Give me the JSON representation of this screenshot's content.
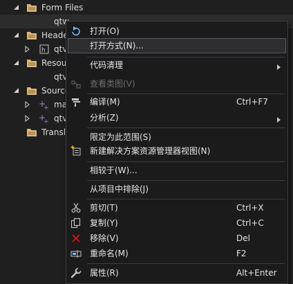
{
  "tree": {
    "form_files": "Form Files",
    "form_child": "qtw",
    "header_files": "Heade",
    "header_child": "qtv",
    "resource_files": "Resou",
    "resource_child": "qtv",
    "source_files": "Source",
    "source_child1": "ma",
    "source_child2": "qtv",
    "translation_files": "Transl"
  },
  "menu": {
    "open": "打开(O)",
    "open_with": "打开方式(N)...",
    "code_cleanup": "代码清理",
    "view_class_diagram": "查看类图(V)",
    "compile": "编译(M)",
    "compile_shortcut": "Ctrl+F7",
    "analyze": "分析(Z)",
    "scope_to_this": "限定为此范围(S)",
    "new_solution_explorer_view": "新建解决方案资源管理器视图(N)",
    "compare_with": "相较于(W)...",
    "exclude_from_project": "从项目中排除(J)",
    "cut": "剪切(T)",
    "cut_shortcut": "Ctrl+X",
    "copy": "复制(Y)",
    "copy_shortcut": "Ctrl+C",
    "remove": "移除(V)",
    "remove_shortcut": "Del",
    "rename": "重命名(M)",
    "rename_shortcut": "F2",
    "properties": "属性(R)",
    "properties_shortcut": "Alt+Enter"
  },
  "icons": {
    "open": "open-arrow-icon",
    "class_diagram": "class-diagram-icon",
    "compile": "compile-icon",
    "new_view": "new-view-icon",
    "cut": "scissors-icon",
    "copy": "copy-icon",
    "remove": "remove-x-icon",
    "rename": "rename-icon",
    "properties": "wrench-icon"
  },
  "colors": {
    "background": "#1f1f1f",
    "menu_background": "#1b1b1c",
    "accent_blue": "#75beff",
    "folder": "#dcb67a",
    "remove_red": "#e51400"
  }
}
